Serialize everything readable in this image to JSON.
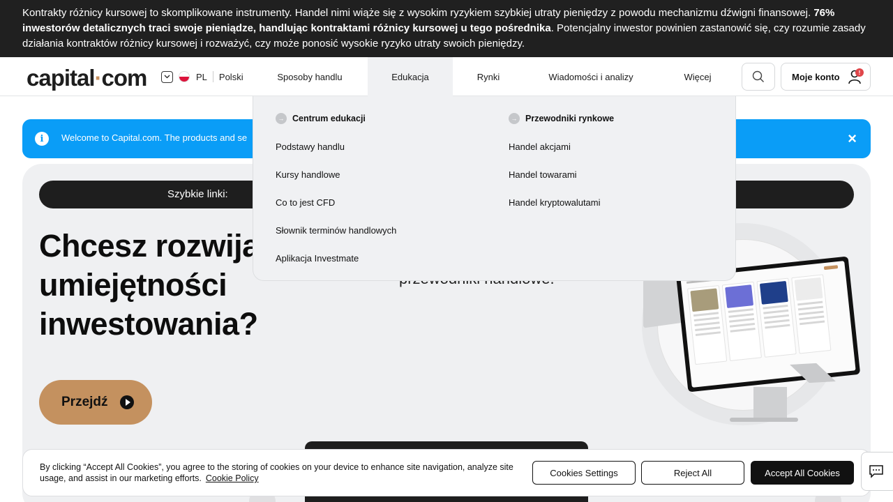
{
  "risk_banner": {
    "part1": "Kontrakty różnicy kursowej to skomplikowane instrumenty. Handel nimi wiąże się z wysokim ryzykiem szybkiej utraty pieniędzy z powodu mechanizmu dźwigni finansowej. ",
    "bold": "76% inwestorów detalicznych traci swoje pieniądze, handlując kontraktami różnicy kursowej u tego pośrednika",
    "part2": ". Potencjalny inwestor powinien zastanowić się, czy rozumie zasady działania kontraktów różnicy kursowej i rozważyć, czy może ponosić wysokie ryzyko utraty swoich pieniędzy."
  },
  "header": {
    "logo_left": "capital",
    "logo_dot": "·",
    "logo_right": "com",
    "lang_code": "PL",
    "lang_name": "Polski",
    "nav": [
      "Sposoby handlu",
      "Edukacja",
      "Rynki",
      "Wiadomości i analizy",
      "Więcej"
    ],
    "account_label": "Moje konto",
    "account_badge": "!"
  },
  "welcome": {
    "text": "Welcome to Capital.com. The products and se",
    "close": "×"
  },
  "hero": {
    "quick_links": "Szybkie linki:",
    "title": "Chcesz rozwijać umiejętności inwestowania?",
    "subtitle": "przewodniki handlowe.",
    "button": "Przejdź"
  },
  "dropdown": {
    "col1_head": "Centrum edukacji",
    "col1_items": [
      "Podstawy handlu",
      "Kursy handlowe",
      "Co to jest CFD",
      "Słownik terminów handlowych",
      "Aplikacja Investmate"
    ],
    "col2_head": "Przewodniki rynkowe",
    "col2_items": [
      "Handel akcjami",
      "Handel towarami",
      "Handel kryptowalutami"
    ]
  },
  "cookie": {
    "text": "By clicking “Accept All Cookies”, you agree to the storing of cookies on your device to enhance site navigation, analyze site usage, and assist in our marketing efforts.",
    "policy": "Cookie Policy",
    "settings": "Cookies Settings",
    "reject": "Reject All",
    "accept": "Accept All Cookies"
  },
  "colors": {
    "accent_bronze": "#c4915f",
    "info_blue": "#0a9df7",
    "dark": "#1e1e1e"
  },
  "icons": [
    "chevron-down-icon",
    "poland-flag-icon",
    "search-icon",
    "user-icon",
    "info-icon",
    "close-icon",
    "play-icon",
    "arrow-right-icon",
    "chat-icon"
  ]
}
